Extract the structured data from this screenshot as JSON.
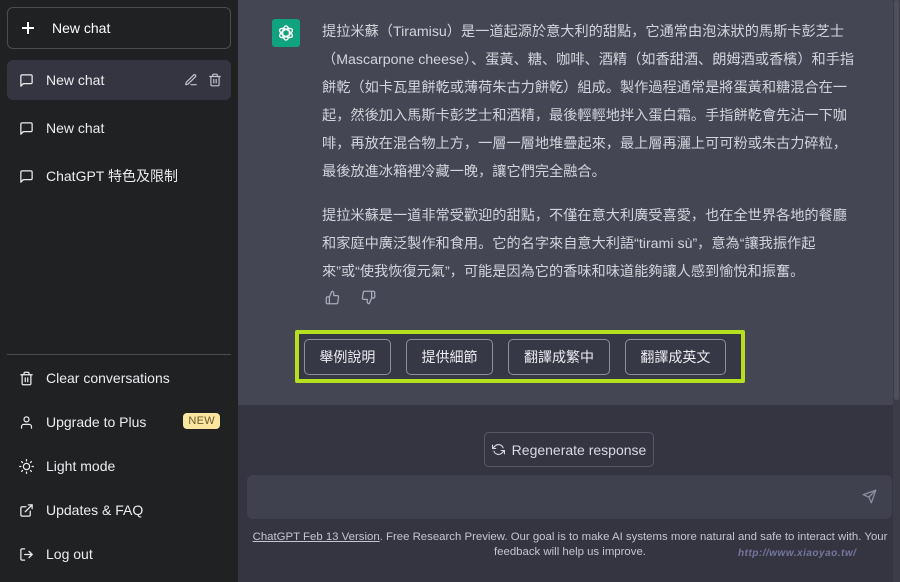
{
  "sidebar": {
    "new_chat_label": "New chat",
    "chats": [
      {
        "label": "New chat",
        "active": true,
        "icon": "message-icon"
      },
      {
        "label": "New chat",
        "active": false,
        "icon": "message-icon"
      },
      {
        "label": "ChatGPT 特色及限制",
        "active": false,
        "icon": "message-icon"
      }
    ],
    "menu": [
      {
        "label": "Clear conversations",
        "icon": "trash-icon"
      },
      {
        "label": "Upgrade to Plus",
        "icon": "user-icon",
        "badge": "NEW"
      },
      {
        "label": "Light mode",
        "icon": "sun-icon"
      },
      {
        "label": "Updates & FAQ",
        "icon": "external-link-icon"
      },
      {
        "label": "Log out",
        "icon": "logout-icon"
      }
    ]
  },
  "conversation": {
    "assistant_message": {
      "paragraphs": [
        "提拉米蘇（Tiramisu）是一道起源於意大利的甜點，它通常由泡沫狀的馬斯卡彭芝士（Mascarpone cheese）、蛋黃、糖、咖啡、酒精（如香甜酒、朗姆酒或香檳）和手指餅乾（如卡瓦里餅乾或薄荷朱古力餅乾）組成。製作過程通常是將蛋黃和糖混合在一起，然後加入馬斯卡彭芝士和酒精，最後輕輕地拌入蛋白霜。手指餅乾會先沾一下咖啡，再放在混合物上方，一層一層地堆疊起來，最上層再灑上可可粉或朱古力碎粒，最後放進冰箱裡冷藏一晚，讓它們完全融合。",
        "提拉米蘇是一道非常受歡迎的甜點，不僅在意大利廣受喜愛，也在全世界各地的餐廳和家庭中廣泛製作和食用。它的名字來自意大利語“tirami sù”，意為“讓我振作起來”或“使我恢復元氣”，可能是因為它的香味和味道能夠讓人感到愉悅和振奮。"
      ]
    },
    "suggestions": [
      "舉例說明",
      "提供細節",
      "翻譯成繁中",
      "翻譯成英文"
    ]
  },
  "composer": {
    "regenerate_label": "Regenerate response",
    "input_value": "",
    "input_placeholder": ""
  },
  "footer": {
    "version_link": "ChatGPT Feb 13 Version",
    "text": ". Free Research Preview. Our goal is to make AI systems more natural and safe to interact with. Your feedback will help us improve."
  },
  "watermark": "http://www.xiaoyao.tw/",
  "colors": {
    "brand": "#10a37f",
    "highlight": "#b6e01c",
    "badge": "#fae69e"
  }
}
